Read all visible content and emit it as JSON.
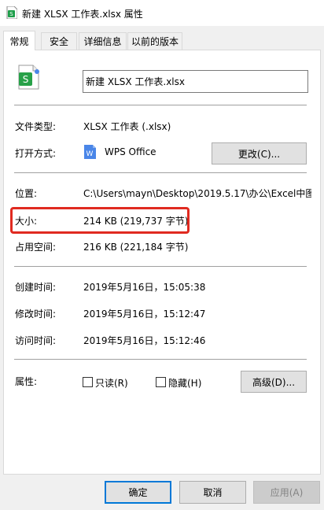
{
  "window": {
    "title": "新建 XLSX 工作表.xlsx 属性"
  },
  "tabs": [
    {
      "label": "常规",
      "active": true
    },
    {
      "label": "安全"
    },
    {
      "label": "详细信息"
    },
    {
      "label": "以前的版本"
    }
  ],
  "general": {
    "filename": "新建 XLSX 工作表.xlsx",
    "file_type_label": "文件类型:",
    "file_type_value": "XLSX 工作表 (.xlsx)",
    "open_with_label": "打开方式:",
    "open_with_value": "WPS Office",
    "change_button": "更改(C)...",
    "location_label": "位置:",
    "location_value": "C:\\Users\\mayn\\Desktop\\2019.5.17\\办公\\Excel中图",
    "size_label": "大小:",
    "size_value": "214 KB (219,737 字节)",
    "size_on_disk_label": "占用空间:",
    "size_on_disk_value": "216 KB (221,184 字节)",
    "created_label": "创建时间:",
    "created_value": "2019年5月16日，15:05:38",
    "modified_label": "修改时间:",
    "modified_value": "2019年5月16日，15:12:47",
    "accessed_label": "访问时间:",
    "accessed_value": "2019年5月16日，15:12:46",
    "attributes_label": "属性:",
    "readonly_label": "只读(R)",
    "hidden_label": "隐藏(H)",
    "advanced_button": "高级(D)..."
  },
  "footer": {
    "ok": "确定",
    "cancel": "取消",
    "apply": "应用(A)"
  },
  "colors": {
    "highlight": "#e02a20",
    "accent": "#0078d7",
    "file_icon": "#4caf50",
    "wps_icon": "#4a86e8"
  }
}
